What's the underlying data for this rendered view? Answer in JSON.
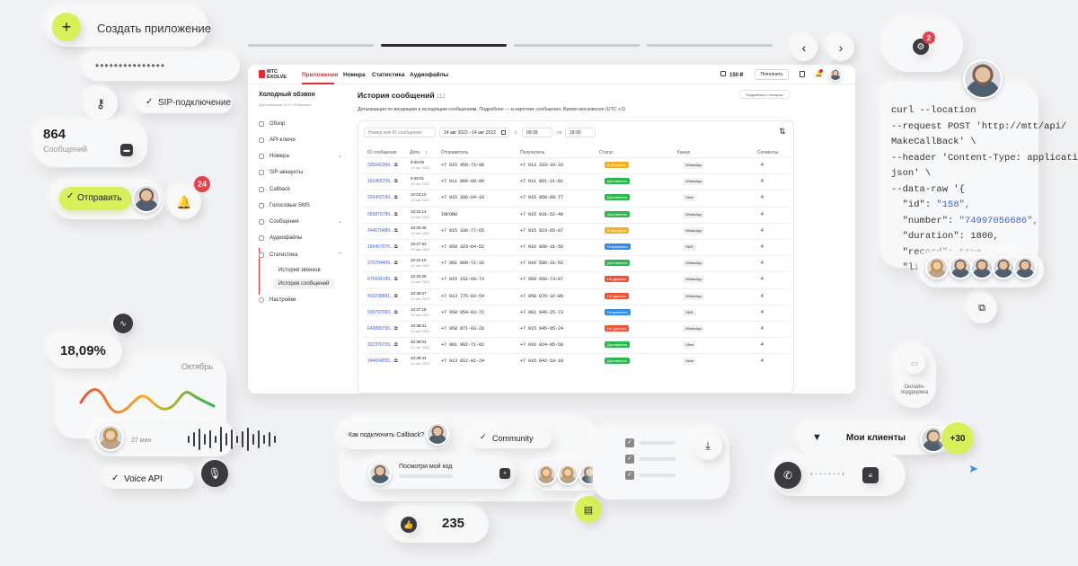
{
  "header_app": "Создать приложение",
  "sip": "SIP-подключение",
  "msgcount": {
    "value": "864",
    "label": "Сообщений"
  },
  "send": "Отправить",
  "badges": {
    "bell": "24",
    "cloud": "2"
  },
  "stat": {
    "value": "18,09%",
    "month": "Октябрь"
  },
  "audio_time": "27 мин",
  "voice_api": "Voice API",
  "chat": {
    "question": "Как подключить Callback?",
    "reply": "Посмотри мой код",
    "likes": "235"
  },
  "community": "Community",
  "clients": {
    "label": "Мои клиенты",
    "count": "+30"
  },
  "support": "Онлайн-поддержка",
  "code": {
    "l1": "curl --location",
    "l2": "--request POST 'http://mtt/api/",
    "l3": "MakeCallBack' \\",
    "l4": "--header 'Content-Type: application/",
    "l5": "json' \\",
    "l6": "--data-raw '{",
    "l7k": "\"id\": ",
    "l7v": "\"158\",",
    "l8k": "\"number\": ",
    "l8v": "\"74997056686\",",
    "l9": "\"duration\": 1800,",
    "l10": "\"record\": true,",
    "l11k": "\"line_1\": ",
    "l11v": "{"
  },
  "app": {
    "logo1": "МТС",
    "logo2": "EXOLVE",
    "nav": [
      "Приложения",
      "Номера",
      "Статистика",
      "Аудиофайлы"
    ],
    "balance": "150 ₽",
    "topup": "Пополнить",
    "project": "Холодный обзвон",
    "project_sub": "Для компании ООО «Ромашка»",
    "side": [
      "Обзор",
      "API-ключи",
      "Номера",
      "SIP-аккаунты",
      "Callback",
      "Голосовые SMS",
      "Сообщения",
      "Аудиофайлы",
      "Статистика",
      "История звонков",
      "История сообщений",
      "Настройки"
    ],
    "title": "История сообщений",
    "title_count": "112",
    "detail_link": "Подробнее о статусах",
    "desc": "Детализация по входящим и исходящим сообщениям. Подробнее — в карточке сообщения. Время московское (UTC +3)",
    "filters": {
      "search": "Номер или ID сообщения",
      "dates": "14 авг 2022 - 14 авг 2022",
      "from": "с",
      "t1": "09:09",
      "to": "по",
      "t2": "18:00"
    },
    "columns": [
      "ID сообщения",
      "Дата",
      "Отправитель",
      "Получатель",
      "Статус",
      "Канал",
      "Сегменты"
    ],
    "rows": [
      {
        "id": "335642369...",
        "time": "9:25:09",
        "date": "14 авг 2022",
        "from": "+7 915 456-73-98",
        "to": "+7 913 333-33-33",
        "status": "В процессе",
        "color": "#f2b01e",
        "ch": "WhatsApp",
        "seg": "4"
      },
      {
        "id": "163465709...",
        "time": "9:48:01",
        "date": "14 авг 2022",
        "from": "+7 911 009-09-09",
        "to": "+7 911 001-21-01",
        "status": "Доставлено",
        "color": "#2cb74f",
        "ch": "WhatsApp",
        "seg": "4"
      },
      {
        "id": "326450743...",
        "time": "10:03:10",
        "date": "14 авг 2022",
        "from": "+7 915 306-64-18",
        "to": "+7 915 058-89-77",
        "status": "Доставлено",
        "color": "#2cb74f",
        "ch": "Viber",
        "seg": "4"
      },
      {
        "id": "055876789...",
        "time": "10:12:14",
        "date": "14 авг 2022",
        "from": "INFORU",
        "to": "+7 915 031-52-40",
        "status": "Доставлено",
        "color": "#2cb74f",
        "ch": "WhatsApp",
        "seg": "4"
      },
      {
        "id": "344670489...",
        "time": "10:26:48",
        "date": "14 авг 2022",
        "from": "+7 915 336-77-65",
        "to": "+7 915 923-65-07",
        "status": "В процессе",
        "color": "#f2b01e",
        "ch": "WhatsApp",
        "seg": "4"
      },
      {
        "id": "169407076...",
        "time": "10:27:52",
        "date": "14 авг 2022",
        "from": "+7 958 323-64-52",
        "to": "+7 916 066-31-56",
        "status": "Отправлено",
        "color": "#2f8ee5",
        "ch": "SMS",
        "seg": "4"
      },
      {
        "id": "370794409...",
        "time": "10:31:10",
        "date": "14 авг 2022",
        "from": "+7 981 099-72-16",
        "to": "+7 916 506-31-52",
        "status": "Доставлено",
        "color": "#2cb74f",
        "ch": "WhatsApp",
        "seg": "4"
      },
      {
        "id": "670934189...",
        "time": "10:34:29",
        "date": "14 авг 2022",
        "from": "+7 915 152-69-73",
        "to": "+7 959 666-73-07",
        "status": "Не удалось",
        "color": "#ef5435",
        "ch": "WhatsApp",
        "seg": "4"
      },
      {
        "id": "403798881...",
        "time": "10:36:57",
        "date": "14 авг 2022",
        "from": "+7 913 775-03-54",
        "to": "+7 958 076-32-88",
        "status": "Не удалось",
        "color": "#ef5435",
        "ch": "WhatsApp",
        "seg": "4"
      },
      {
        "id": "500797283...",
        "time": "10:37:18",
        "date": "14 авг 2022",
        "from": "+7 958 054-03-72",
        "to": "+7 981 046-25-73",
        "status": "Отправлено",
        "color": "#2f8ee5",
        "ch": "SMS",
        "seg": "4"
      },
      {
        "id": "649890795...",
        "time": "10:38:31",
        "date": "14 авг 2022",
        "from": "+7 958 871-03-28",
        "to": "+7 915 045-05-24",
        "status": "Не удалось",
        "color": "#ef5435",
        "ch": "WhatsApp",
        "seg": "4"
      },
      {
        "id": "322376709...",
        "time": "10:39:04",
        "date": "14 авг 2022",
        "from": "+7 981 962-71-82",
        "to": "+7 916 024-05-58",
        "status": "Доставлено",
        "color": "#2cb74f",
        "ch": "Viber",
        "seg": "4"
      },
      {
        "id": "344694955...",
        "time": "10:39:44",
        "date": "14 авг 2022",
        "from": "+7 913 812-81-24",
        "to": "+7 915 042-18-18",
        "status": "Доставлено",
        "color": "#2cb74f",
        "ch": "Viber",
        "seg": "4"
      }
    ]
  },
  "colors": {
    "accent": "#e32b36",
    "lime": "#d8f05a",
    "link": "#3d63d8"
  }
}
